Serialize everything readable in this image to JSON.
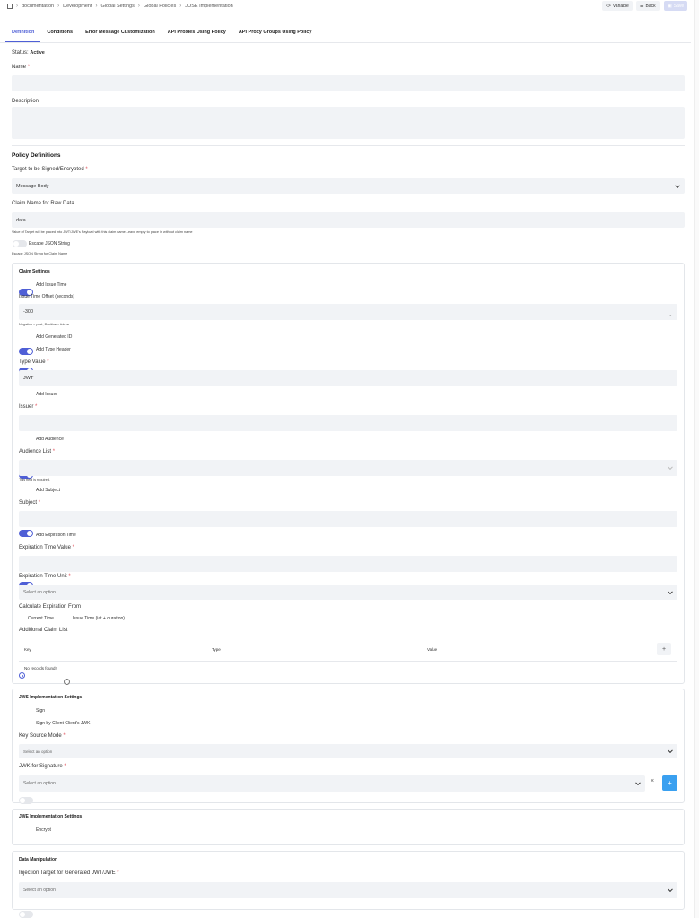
{
  "breadcrumb": [
    "documentation",
    "Development",
    "Global Settings",
    "Global Policies",
    "JOSE Implementation"
  ],
  "toolbar": {
    "variable_label": "Variable",
    "back_label": "Back",
    "save_label": "Save"
  },
  "tabs": [
    "Definition",
    "Conditions",
    "Error Message Customization",
    "API Proxies Using Policy",
    "API Proxy Groups Using Policy"
  ],
  "status": {
    "label": "Status:",
    "value": "Active"
  },
  "name": {
    "label": "Name",
    "value": ""
  },
  "description": {
    "label": "Description",
    "value": ""
  },
  "policy_definitions": {
    "title": "Policy Definitions",
    "target": {
      "label": "Target to be Signed/Encrypted",
      "value": "Message Body"
    },
    "claim_name": {
      "label": "Claim Name for Raw Data",
      "value": "data",
      "hint": "Value of Target will be placed into JWT/JWE's Payload with this claim name.Leave empty to place in without claim name"
    },
    "escape_json": {
      "label": "Escape JSON String",
      "hint": "Escape JSON String for Claim Name"
    }
  },
  "claim_settings": {
    "title": "Claim Settings",
    "add_issue_time": "Add Issue Time",
    "issue_time_offset": {
      "label": "Issue Time Offset (seconds)",
      "value": "-300",
      "hint": "Negative = past, Positive = future"
    },
    "add_generated_id": "Add Generated ID",
    "add_type_header": "Add Type Header",
    "type_value": {
      "label": "Type Value",
      "value": "JWT"
    },
    "add_issuer": "Add Issuer",
    "issuer": {
      "label": "Issuer",
      "value": ""
    },
    "add_audience": "Add Audience",
    "audience_list": {
      "label": "Audience List",
      "value": "",
      "error": "This field is required."
    },
    "add_subject": "Add Subject",
    "subject": {
      "label": "Subject",
      "value": ""
    },
    "add_expiration_time": "Add Expiration Time",
    "expiration_time_value": {
      "label": "Expiration Time Value",
      "value": ""
    },
    "expiration_time_unit": {
      "label": "Expiration Time Unit",
      "placeholder": "Select an option"
    },
    "calculate_expiration": {
      "label": "Calculate Expiration From",
      "options": [
        "Current Time",
        "Issue Time (iat + duration)"
      ]
    },
    "additional_claims": {
      "label": "Additional Claim List",
      "columns": [
        "Key",
        "Type",
        "Value"
      ],
      "add_button": "+",
      "empty": "No records found!"
    }
  },
  "jws": {
    "title": "JWS Implementation Settings",
    "sign": "Sign",
    "sign_by_client": "Sign by Client Client's JWK",
    "key_source_mode": {
      "label": "Key Source Mode",
      "placeholder": "Select an option"
    },
    "jwk_for_signature": {
      "label": "JWK for Signature",
      "placeholder": "Select an option",
      "clear": "×",
      "add": "+"
    }
  },
  "jwe": {
    "title": "JWE Implementation Settings",
    "encrypt": "Encrypt"
  },
  "data_manipulation": {
    "title": "Data Manipulation",
    "injection_target": {
      "label": "Injection Target for Generated JWT/JWE",
      "placeholder": "Select an option"
    }
  }
}
